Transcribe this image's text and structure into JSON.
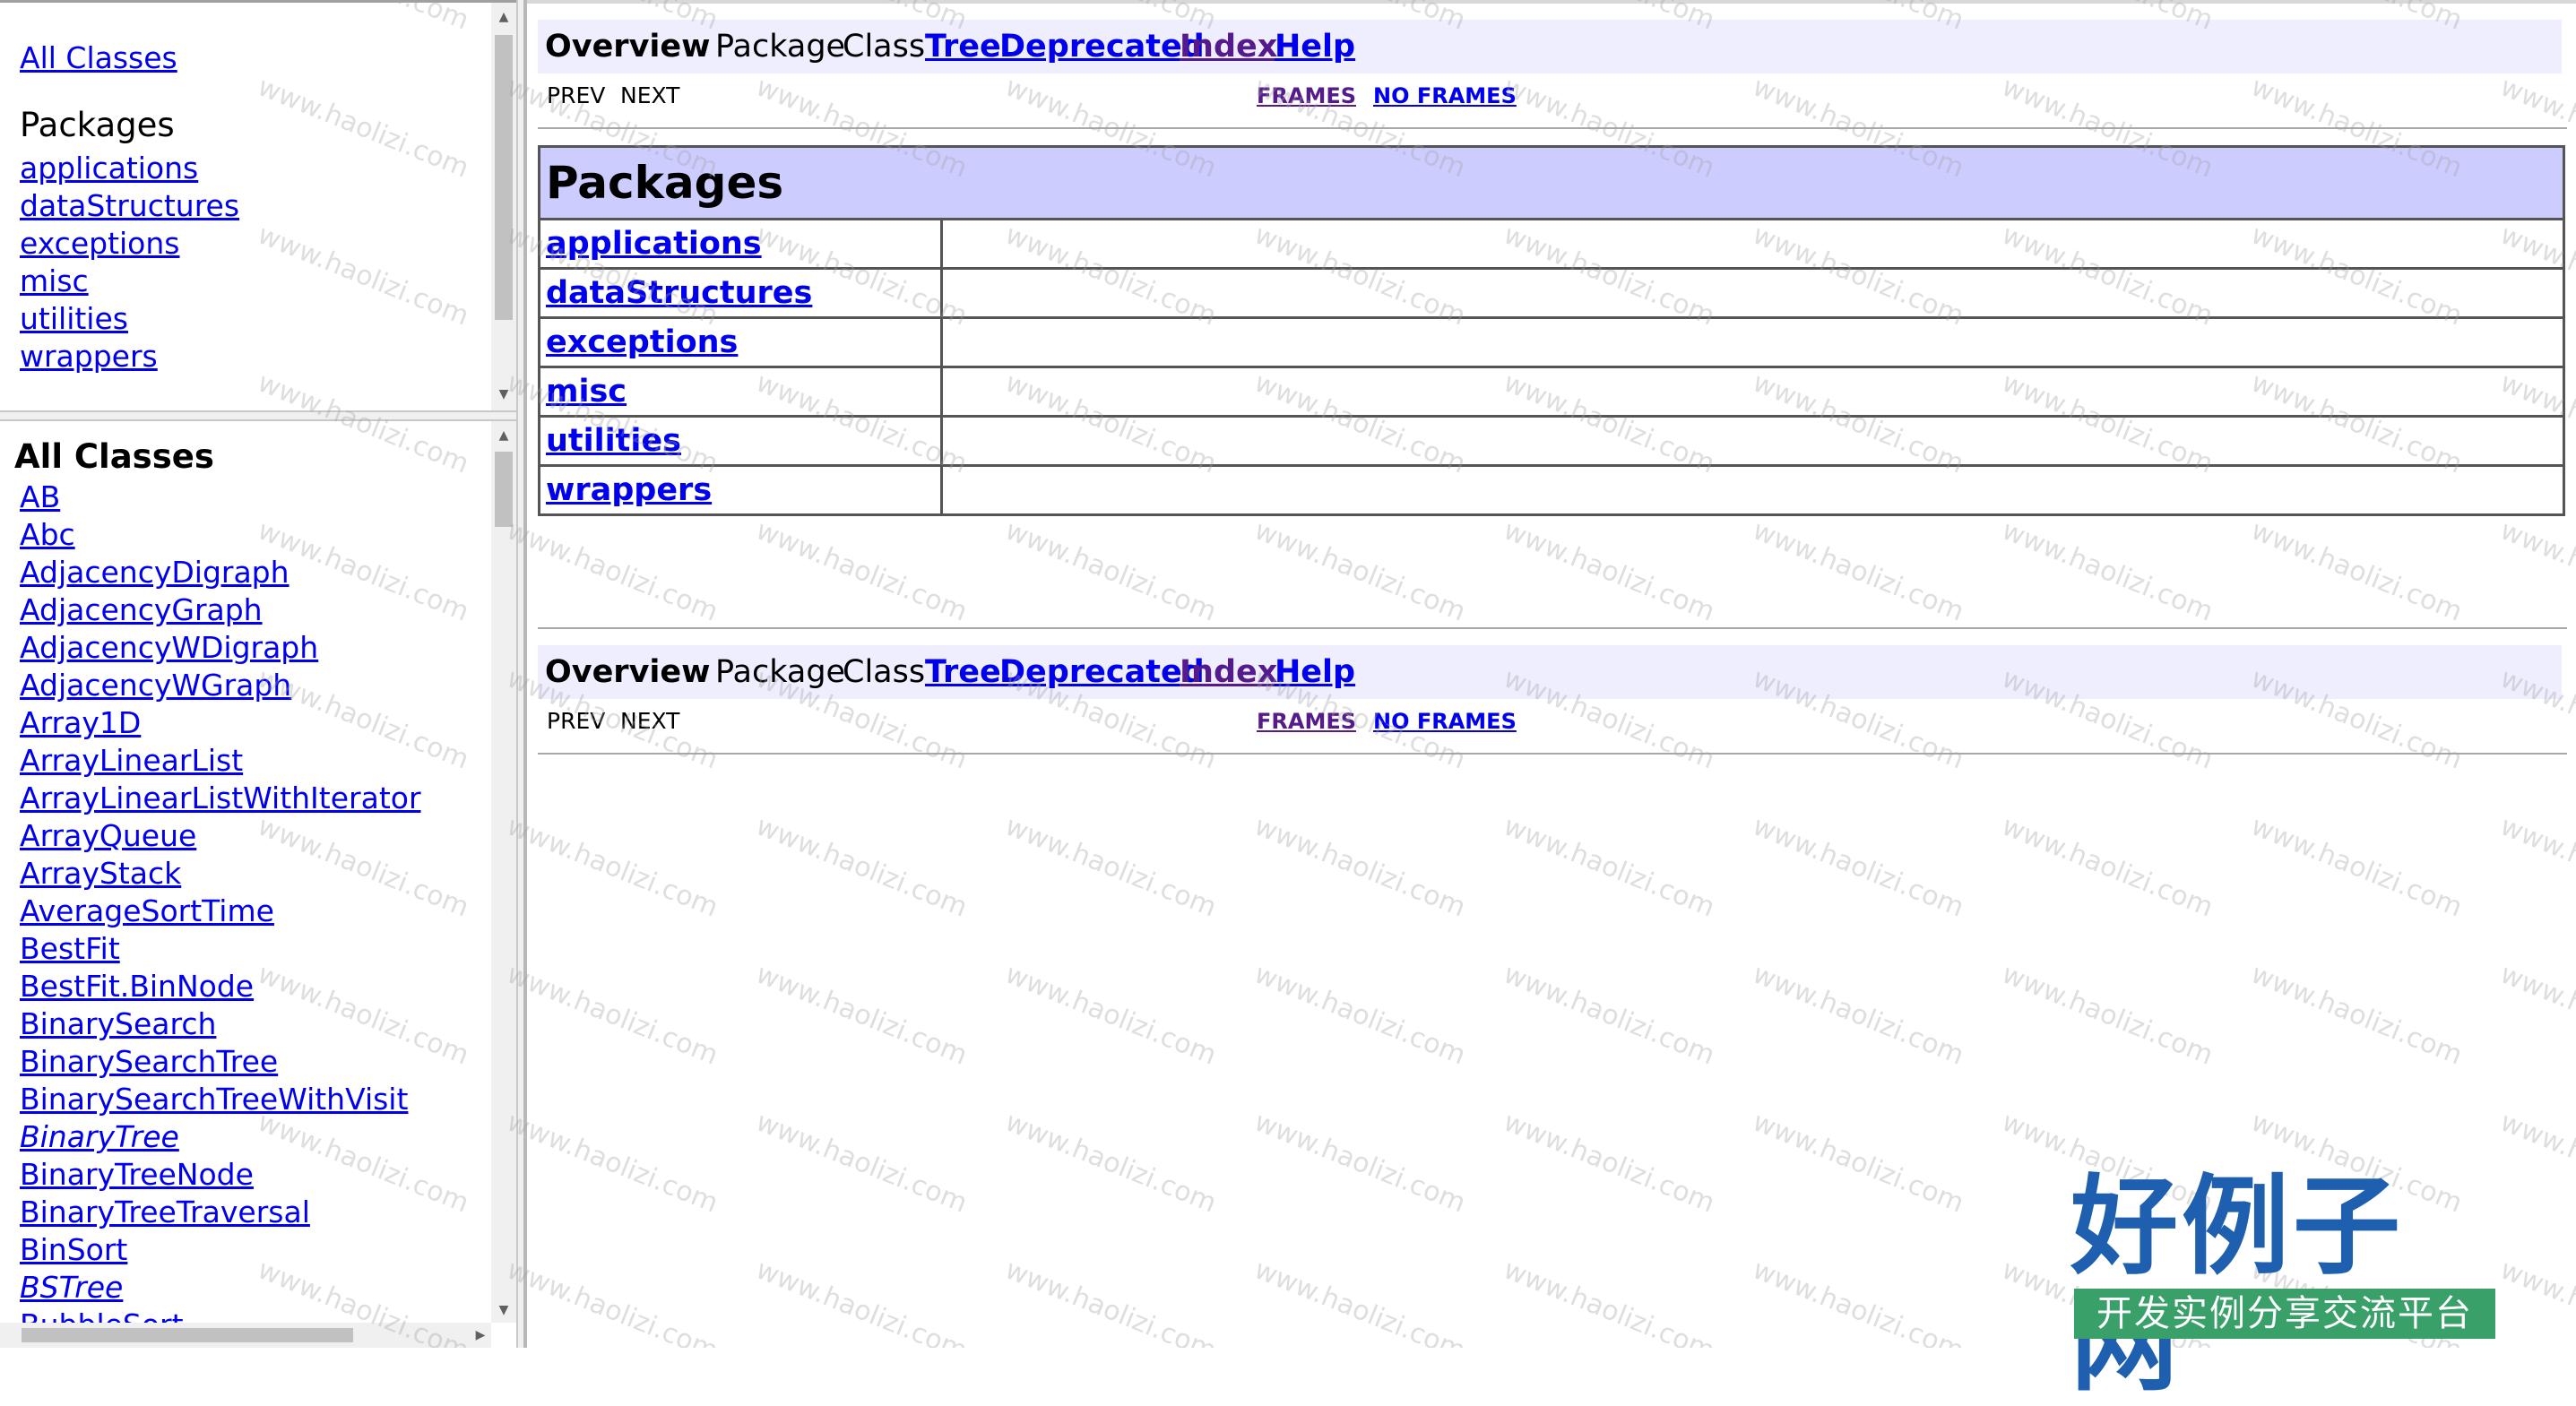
{
  "package_frame": {
    "all_classes_link": "All Classes",
    "heading": "Packages",
    "packages": [
      "applications",
      "dataStructures",
      "exceptions",
      "misc",
      "utilities",
      "wrappers"
    ]
  },
  "class_frame": {
    "heading": "All Classes",
    "classes": [
      {
        "name": "AB",
        "italic": false
      },
      {
        "name": "Abc",
        "italic": false
      },
      {
        "name": "AdjacencyDigraph",
        "italic": false
      },
      {
        "name": "AdjacencyGraph",
        "italic": false
      },
      {
        "name": "AdjacencyWDigraph",
        "italic": false
      },
      {
        "name": "AdjacencyWGraph",
        "italic": false
      },
      {
        "name": "Array1D",
        "italic": false
      },
      {
        "name": "ArrayLinearList",
        "italic": false
      },
      {
        "name": "ArrayLinearListWithIterator",
        "italic": false
      },
      {
        "name": "ArrayQueue",
        "italic": false
      },
      {
        "name": "ArrayStack",
        "italic": false
      },
      {
        "name": "AverageSortTime",
        "italic": false
      },
      {
        "name": "BestFit",
        "italic": false
      },
      {
        "name": "BestFit.BinNode",
        "italic": false
      },
      {
        "name": "BinarySearch",
        "italic": false
      },
      {
        "name": "BinarySearchTree",
        "italic": false
      },
      {
        "name": "BinarySearchTreeWithVisit",
        "italic": false
      },
      {
        "name": "BinaryTree",
        "italic": true
      },
      {
        "name": "BinaryTreeNode",
        "italic": false
      },
      {
        "name": "BinaryTreeTraversal",
        "italic": false
      },
      {
        "name": "BinSort",
        "italic": false
      },
      {
        "name": "BSTree",
        "italic": true
      },
      {
        "name": "BubbleSort",
        "italic": false
      }
    ]
  },
  "main": {
    "nav_top": {
      "overview": "Overview",
      "package": "Package",
      "class": "Class",
      "tree": "Tree",
      "deprecated": "Deprecated",
      "index": "Index",
      "help": "Help",
      "prev": "PREV",
      "next": "NEXT",
      "frames": "FRAMES",
      "no_frames": "NO FRAMES"
    },
    "table": {
      "heading": "Packages",
      "rows": [
        {
          "name": "applications",
          "description": ""
        },
        {
          "name": "dataStructures",
          "description": ""
        },
        {
          "name": "exceptions",
          "description": ""
        },
        {
          "name": "misc",
          "description": ""
        },
        {
          "name": "utilities",
          "description": ""
        },
        {
          "name": "wrappers",
          "description": ""
        }
      ]
    },
    "nav_bottom": {
      "overview": "Overview",
      "package": "Package",
      "class": "Class",
      "tree": "Tree",
      "deprecated": "Deprecated",
      "index": "Index",
      "help": "Help",
      "prev": "PREV",
      "next": "NEXT",
      "frames": "FRAMES",
      "no_frames": "NO FRAMES"
    }
  },
  "watermark": {
    "text": "www.haolizi.com",
    "logo_title": "好例子网",
    "logo_subtitle": "开发实例分享交流平台"
  },
  "colors": {
    "link": "#0000ee",
    "visited_link": "#551a8b",
    "navbar_bg": "#eeeeff",
    "table_header_bg": "#ccccff",
    "logo_blue": "#1f5fb0",
    "logo_green": "#3aa06a"
  }
}
